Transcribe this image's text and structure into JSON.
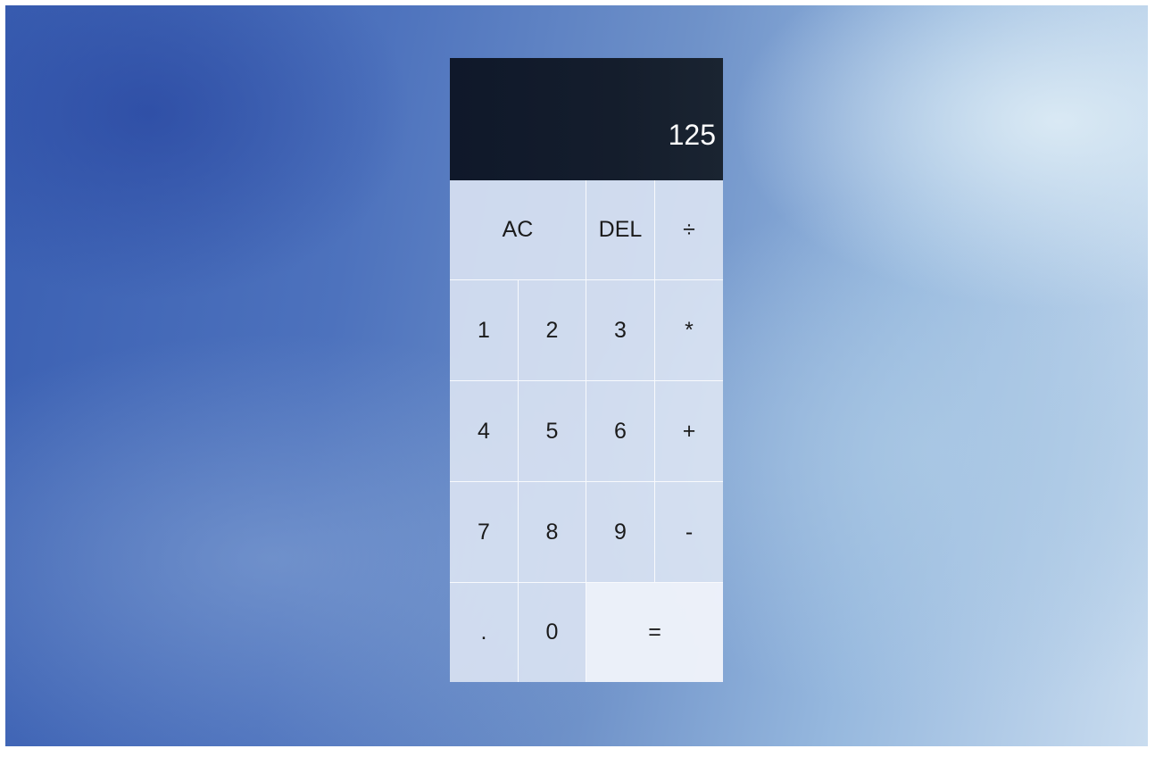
{
  "display": {
    "value": "125"
  },
  "keys": {
    "clear": "AC",
    "delete": "DEL",
    "divide": "÷",
    "one": "1",
    "two": "2",
    "three": "3",
    "multiply": "*",
    "four": "4",
    "five": "5",
    "six": "6",
    "add": "+",
    "seven": "7",
    "eight": "8",
    "nine": "9",
    "subtract": "-",
    "decimal": ".",
    "zero": "0",
    "equals": "="
  },
  "colors": {
    "display_background": "#121b2b",
    "key_background": "#dee6f4",
    "equals_background": "#eef2fa",
    "backdrop_accent": "#4d72bd"
  }
}
